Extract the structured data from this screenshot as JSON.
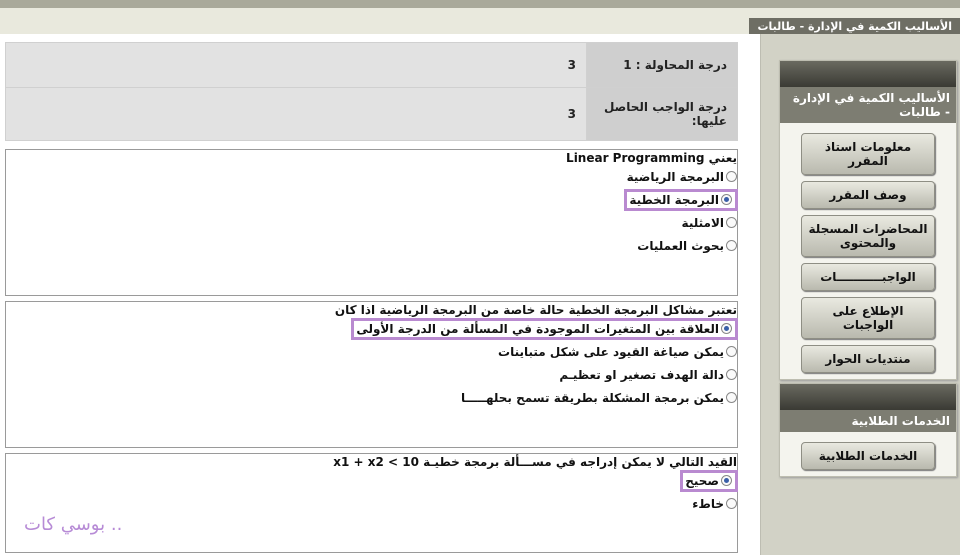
{
  "window": {
    "title": "الأساليب الكمية في الإدارة - طالبات"
  },
  "grades": [
    {
      "label": "درجة المحاولة : 1",
      "value": "3"
    },
    {
      "label": "درجة الواجب الحاصل عليها:",
      "value": "3"
    }
  ],
  "questions": [
    {
      "title": "يعني Linear Programming",
      "options": [
        {
          "text": "البرمجة الرياضية",
          "selected": false
        },
        {
          "text": "البرمجة الخطية",
          "selected": true
        },
        {
          "text": "الامثلية",
          "selected": false
        },
        {
          "text": "بحوث العمليات",
          "selected": false
        }
      ]
    },
    {
      "title": "تعتبر مشاكل البرمجة الخطية حالة خاصة من البرمجة الرياضية اذا كان",
      "options": [
        {
          "text": "العلاقة بين المتغيرات الموجودة في المسألة من الدرجة الأولى",
          "selected": true
        },
        {
          "text": "يمكن صياغة القيود على شكل متباينات",
          "selected": false
        },
        {
          "text": "دالة الهدف تصغير او تعظيـم",
          "selected": false
        },
        {
          "text": "يمكن برمجة المشكلة بطريقة تسمح بحلهـــــا",
          "selected": false
        }
      ]
    },
    {
      "title": "القيد التالي لا يمكن إدراجه في مســـألة برمجة خطيـة 10 > x1 + x2",
      "options": [
        {
          "text": "صحيح",
          "selected": true
        },
        {
          "text": "خاطء",
          "selected": false
        }
      ]
    }
  ],
  "watermark": "بوسي كات ..",
  "sidebar": {
    "course_header": "الأساليب الكمية في الإدارة - طالبات",
    "course_buttons": [
      "معلومات استاذ المقرر",
      "وصف المقرر",
      "المحاضرات المسجلة والمحتوى",
      "الواجبـــــــــــات",
      "الإطلاع على الواجبات",
      "منتديات الحوار"
    ],
    "services_header": "الخدمات الطلابية",
    "services_buttons": [
      "الخدمات الطلابية"
    ]
  },
  "colors": {
    "highlight": "#b98ad0",
    "panel_header": "#7d7d72"
  }
}
